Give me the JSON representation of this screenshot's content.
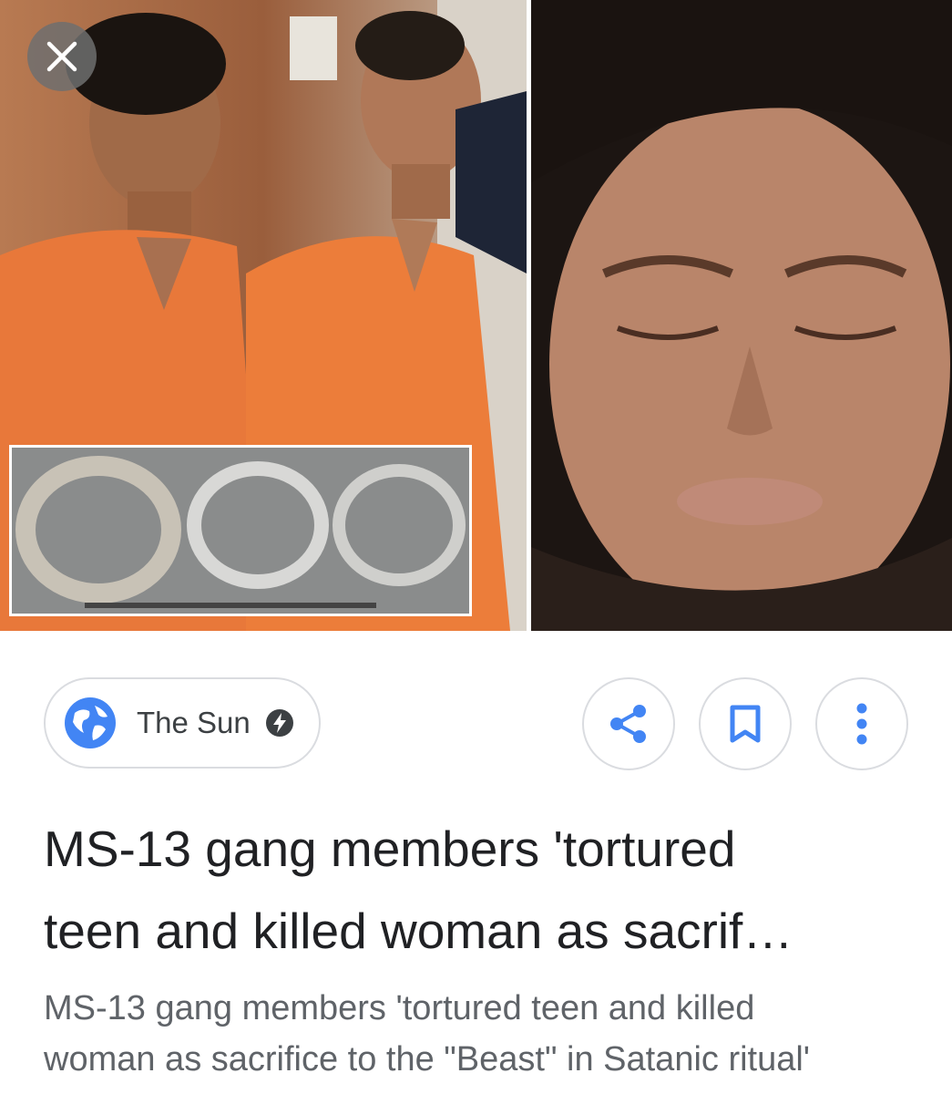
{
  "source": {
    "name": "The Sun",
    "icon": "globe-icon",
    "badge_icon": "amp-bolt-icon"
  },
  "actions": {
    "share_icon": "share-icon",
    "bookmark_icon": "bookmark-icon",
    "more_icon": "more-vert-icon"
  },
  "article": {
    "title_line1": "MS-13 gang members 'tortured",
    "title_line2": "teen and killed woman as sacrif…",
    "description_line1": "MS-13 gang members 'tortured teen and killed",
    "description_line2": "woman as sacrifice to the \"Beast\" in Satanic ritual'"
  },
  "colors": {
    "accent_blue": "#4285f4",
    "border": "#dadce0",
    "title": "#202124",
    "secondary": "#5f6368"
  }
}
